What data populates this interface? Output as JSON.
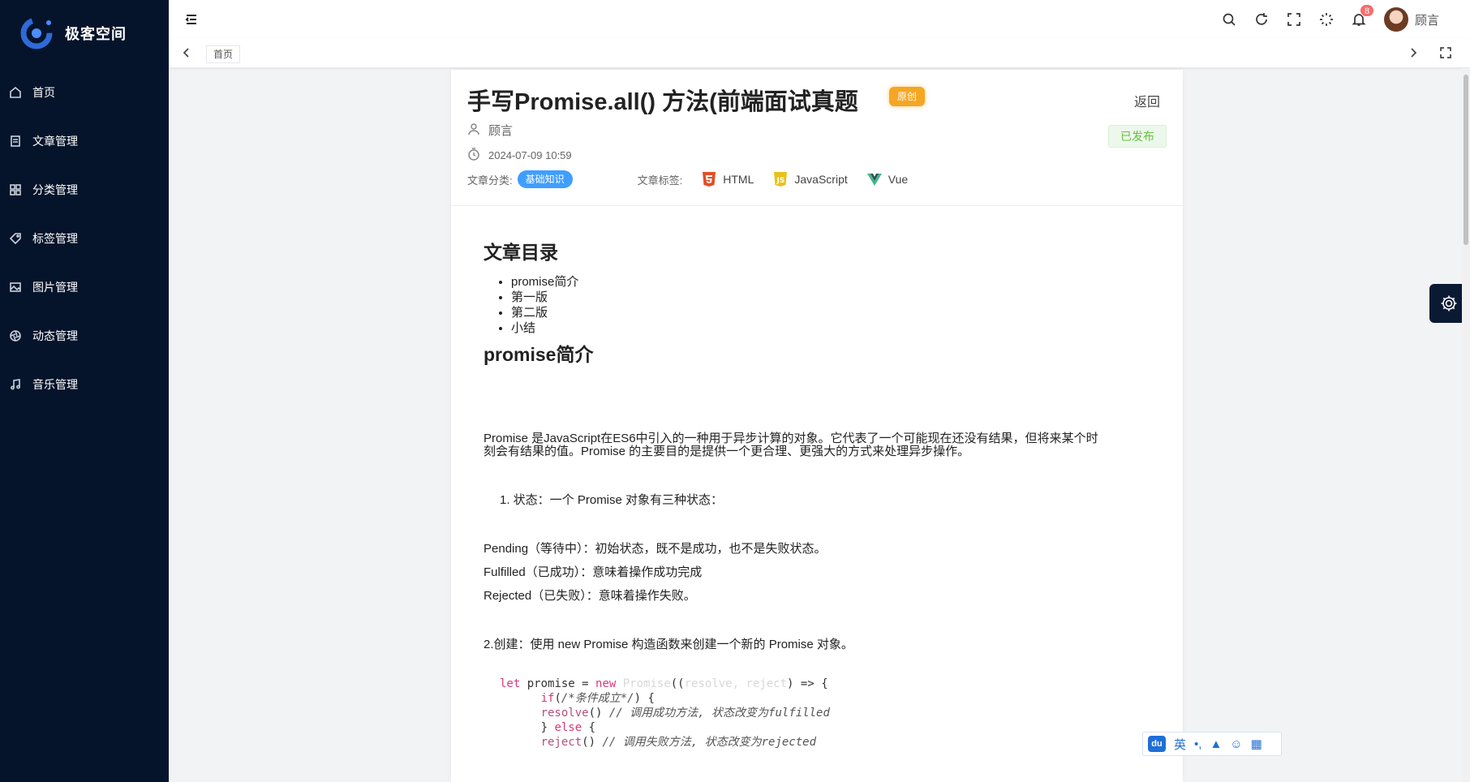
{
  "app": {
    "name": "极客空间"
  },
  "sidebar": {
    "items": [
      {
        "label": "首页",
        "icon": "home-icon"
      },
      {
        "label": "文章管理",
        "icon": "document-icon"
      },
      {
        "label": "分类管理",
        "icon": "grid-icon"
      },
      {
        "label": "标签管理",
        "icon": "tag-icon"
      },
      {
        "label": "图片管理",
        "icon": "image-icon"
      },
      {
        "label": "动态管理",
        "icon": "aperture-icon"
      },
      {
        "label": "音乐管理",
        "icon": "music-icon"
      }
    ]
  },
  "header": {
    "notification_count": "8",
    "user_name": "顾言"
  },
  "tabs": [
    {
      "label": "首页"
    }
  ],
  "article": {
    "title": "手写Promise.all() 方法(前端面试真题",
    "original_badge": "原创",
    "back_label": "返回",
    "status": "已发布",
    "author": "顾言",
    "date": "2024-07-09 10:59",
    "category_label": "文章分类:",
    "category": "基础知识",
    "tags_label": "文章标签:",
    "tags": [
      "HTML",
      "JavaScript",
      "Vue"
    ]
  },
  "content": {
    "toc_heading": "文章目录",
    "toc": [
      "promise简介",
      "第一版",
      "第二版",
      "小结"
    ],
    "section_heading": "promise简介",
    "para1_line1": "Promise 是JavaScript在ES6中引入的一种用于异步计算的对象。它代表了一个可能现在还没有结果，但将来某个时",
    "para1_line2": "刻会有结果的值。Promise 的主要目的是提供一个更合理、更强大的方式来处理异步操作。",
    "state_intro": "1. 状态：一个 Promise 对象有三种状态：",
    "pending": "Pending（等待中）：初始状态，既不是成功，也不是失败状态。",
    "fulfilled": "Fulfilled（已成功）：意味着操作成功完成",
    "rejected": "Rejected（已失败）：意味着操作失败。",
    "create": "2.创建：使用 new Promise 构造函数来创建一个新的 Promise 对象。",
    "code": {
      "l1a": "let",
      "l1b": " promise = ",
      "l1c": "new",
      "l1d": " Promise",
      "l1e": "((",
      "l1f": "resolve, reject",
      "l1g": ") => {",
      "l2a": "if",
      "l2b": "(",
      "l2c": "/*条件成立*/",
      "l2d": ") {",
      "l3a": "resolve",
      "l3b": "() ",
      "l3c": "// 调用成功方法, 状态改变为fulfilled",
      "l4a": "} ",
      "l4b": "else",
      "l4c": " {",
      "l5a": "reject",
      "l5b": "() ",
      "l5c": "// 调用失败方法, 状态改变为rejected"
    }
  },
  "ime": {
    "lang": "英"
  }
}
